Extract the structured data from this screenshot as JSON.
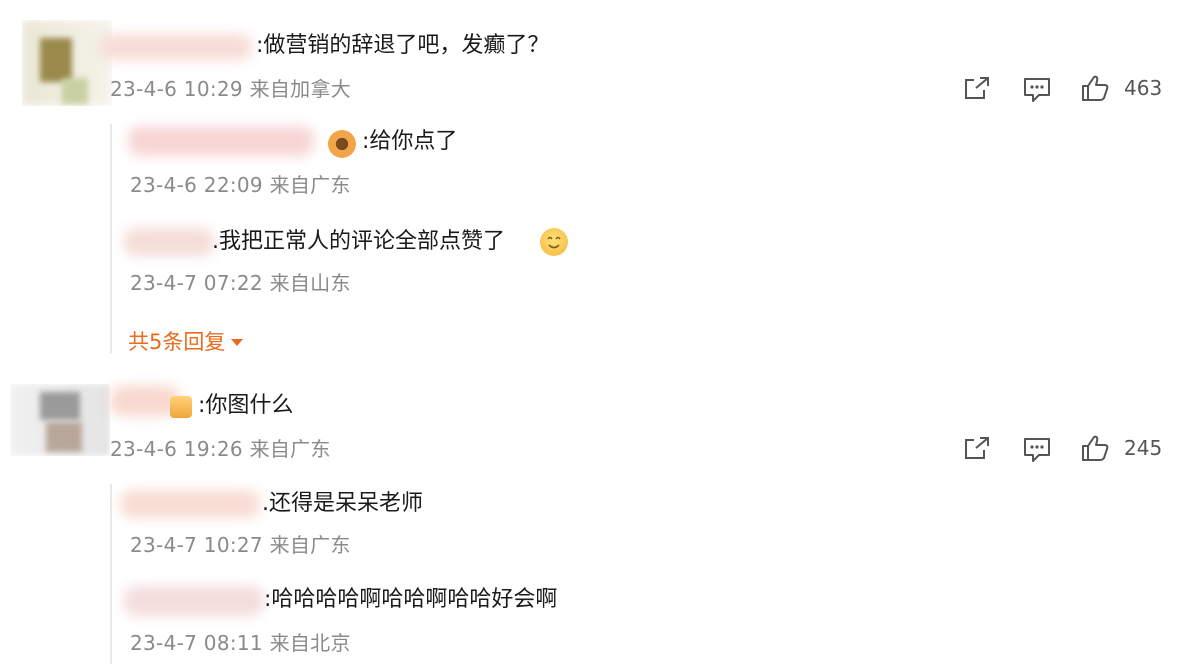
{
  "comments": [
    {
      "text": ":做营销的辞退了吧，发癫了？",
      "meta": "23-4-6 10:29 来自加拿大",
      "likes": "463",
      "replies": [
        {
          "text": ":给你点了",
          "meta": "23-4-6 22:09 来自广东"
        },
        {
          "text": ".我把正常人的评论全部点赞了",
          "meta": "23-4-7 07:22 来自山东"
        }
      ],
      "more_label": "共5条回复"
    },
    {
      "text": ":你图什么",
      "meta": "23-4-6 19:26 来自广东",
      "likes": "245",
      "replies": [
        {
          "text": ".还得是呆呆老师",
          "meta": "23-4-7 10:27 来自广东"
        },
        {
          "text": ":哈哈哈哈啊哈哈啊哈哈好会啊",
          "meta": "23-4-7 08:11 来自北京"
        }
      ]
    }
  ],
  "icons": [
    "share-icon",
    "comment-icon",
    "like-icon"
  ],
  "colors": {
    "accent": "#e86b1f",
    "meta": "#8a8a8a",
    "icon": "#555555"
  }
}
